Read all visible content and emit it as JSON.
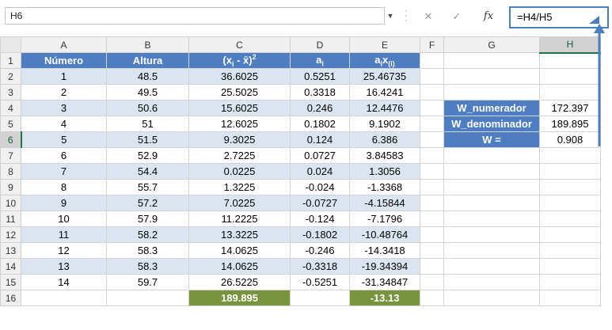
{
  "namebox": {
    "value": "H6"
  },
  "formula_bar": {
    "cancel": "✕",
    "enter": "✓",
    "fx": "fx",
    "value": "=H4/H5"
  },
  "columns": [
    "A",
    "B",
    "C",
    "D",
    "E",
    "F",
    "G",
    "H"
  ],
  "headers": {
    "a": "Número",
    "b": "Altura",
    "d": "a",
    "d_sub": "i",
    "e_a": "a",
    "e_a_sub": "i",
    "e_x": "x",
    "e_x_sub": "(i)"
  },
  "rows": [
    {
      "n": "2",
      "a": "1",
      "b": "48.5",
      "c": "36.6025",
      "d": "0.5251",
      "e": "25.46735"
    },
    {
      "n": "3",
      "a": "2",
      "b": "49.5",
      "c": "25.5025",
      "d": "0.3318",
      "e": "16.4241"
    },
    {
      "n": "4",
      "a": "3",
      "b": "50.6",
      "c": "15.6025",
      "d": "0.246",
      "e": "12.4476"
    },
    {
      "n": "5",
      "a": "4",
      "b": "51",
      "c": "12.6025",
      "d": "0.1802",
      "e": "9.1902"
    },
    {
      "n": "6",
      "a": "5",
      "b": "51.5",
      "c": "9.3025",
      "d": "0.124",
      "e": "6.386"
    },
    {
      "n": "7",
      "a": "6",
      "b": "52.9",
      "c": "2.7225",
      "d": "0.0727",
      "e": "3.84583"
    },
    {
      "n": "8",
      "a": "7",
      "b": "54.4",
      "c": "0.0225",
      "d": "0.024",
      "e": "1.3056"
    },
    {
      "n": "9",
      "a": "8",
      "b": "55.7",
      "c": "1.3225",
      "d": "-0.024",
      "e": "-1.3368"
    },
    {
      "n": "10",
      "a": "9",
      "b": "57.2",
      "c": "7.0225",
      "d": "-0.0727",
      "e": "-4.15844"
    },
    {
      "n": "11",
      "a": "10",
      "b": "57.9",
      "c": "11.2225",
      "d": "-0.124",
      "e": "-7.1796"
    },
    {
      "n": "12",
      "a": "11",
      "b": "58.2",
      "c": "13.3225",
      "d": "-0.1802",
      "e": "-10.48764"
    },
    {
      "n": "13",
      "a": "12",
      "b": "58.3",
      "c": "14.0625",
      "d": "-0.246",
      "e": "-14.3418"
    },
    {
      "n": "14",
      "a": "13",
      "b": "58.3",
      "c": "14.0625",
      "d": "-0.3318",
      "e": "-19.34394"
    },
    {
      "n": "15",
      "a": "14",
      "b": "59.7",
      "c": "26.5225",
      "d": "-0.5251",
      "e": "-31.34847"
    }
  ],
  "totals": {
    "c": "189.895",
    "e": "-13.13"
  },
  "side": {
    "numerador_label": "W_numerador",
    "numerador_value": "172.397",
    "denominador_label": "W_denominador",
    "denominador_value": "189.895",
    "w_label": "W =",
    "w_value": "0.908"
  },
  "colors": {
    "header_blue": "#4e7ec1",
    "band_blue": "#dbe5f1",
    "total_green": "#77933c",
    "arrow": "#4a7ebf"
  }
}
